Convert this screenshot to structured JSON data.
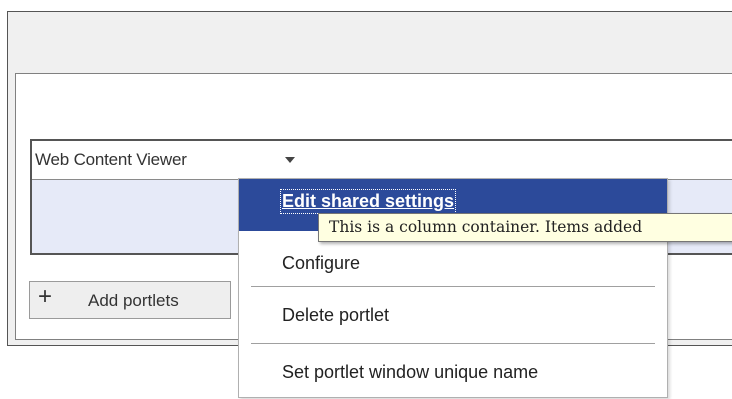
{
  "portlet": {
    "title": "Web Content Viewer",
    "menu_icon": "caret-down-icon"
  },
  "add_portlets": {
    "icon": "plus-icon",
    "label": "Add portlets"
  },
  "menu": {
    "items": [
      {
        "label": "Edit shared settings",
        "selected": true
      },
      {
        "label": "Configure"
      },
      {
        "label": "Delete portlet"
      },
      {
        "label": "Set portlet window unique name"
      }
    ]
  },
  "tooltip": {
    "text": "This is a column container.  Items added"
  },
  "colors": {
    "menu_selected_bg": "#2c4a9a",
    "portlet_body_bg": "#e6eaf8",
    "tooltip_bg": "#ffffe1"
  }
}
